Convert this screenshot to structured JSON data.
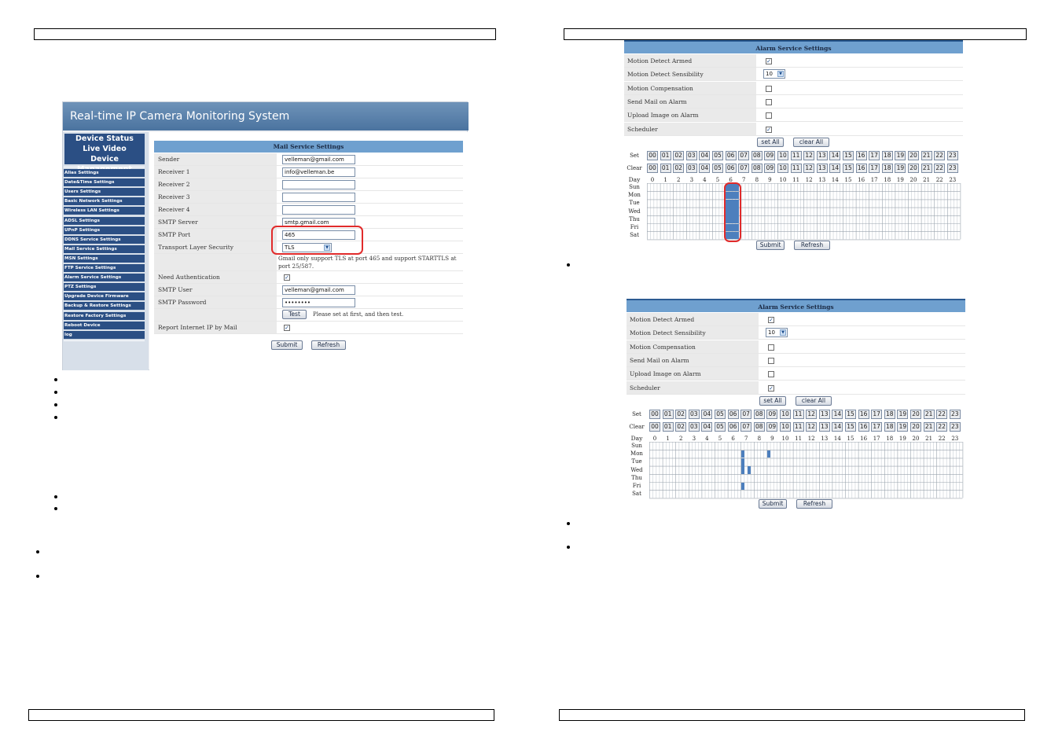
{
  "mail_service": {
    "app_title": "Real-time IP Camera Monitoring System",
    "nav_main": [
      "Device Status",
      "Live Video",
      "Device Management"
    ],
    "nav_sub": [
      "Alias Settings",
      "Date&Time Settings",
      "Users Settings",
      "Basic Network Settings",
      "Wireless LAN Settings",
      "ADSL Settings",
      "UPnP Settings",
      "DDNS Service Settings",
      "Mail Service Settings",
      "MSN Settings",
      "FTP Service Settings",
      "Alarm Service Settings",
      "PTZ Settings",
      "Upgrade Device Firmware",
      "Backup & Restore Settings",
      "Restore Factory Settings",
      "Reboot Device",
      "log"
    ],
    "panel_title": "Mail Service Settings",
    "fields": {
      "sender": {
        "label": "Sender",
        "value": "velleman@gmail.com"
      },
      "receiver1": {
        "label": "Receiver 1",
        "value": "info@velleman.be"
      },
      "receiver2": {
        "label": "Receiver 2",
        "value": ""
      },
      "receiver3": {
        "label": "Receiver 3",
        "value": ""
      },
      "receiver4": {
        "label": "Receiver 4",
        "value": ""
      },
      "smtp_server": {
        "label": "SMTP Server",
        "value": "smtp.gmail.com"
      },
      "smtp_port": {
        "label": "SMTP Port",
        "value": "465"
      },
      "tls": {
        "label": "Transport Layer Security",
        "value": "TLS"
      },
      "tls_note": "Gmail only support TLS at port 465 and support STARTTLS at port 25/587.",
      "need_auth": {
        "label": "Need Authentication",
        "checked": true
      },
      "smtp_user": {
        "label": "SMTP User",
        "value": "velleman@gmail.com"
      },
      "smtp_password": {
        "label": "SMTP Password",
        "value": "••••••••"
      },
      "test_button": "Test",
      "test_note": "Please set at first, and then test.",
      "report_ip": {
        "label": "Report Internet IP by Mail",
        "checked": true
      }
    },
    "submit_label": "Submit",
    "refresh_label": "Refresh"
  },
  "alarm_shared": {
    "title": "Alarm Service Settings",
    "labels": {
      "motion_armed": "Motion Detect Armed",
      "sensibility": "Motion Detect Sensibility",
      "compensation": "Motion Compensation",
      "send_mail": "Send Mail on Alarm",
      "upload_image": "Upload Image on Alarm",
      "scheduler": "Scheduler"
    },
    "sensibility_value": "10",
    "set_all": "set All",
    "clear_all": "clear All",
    "row_set": "Set",
    "row_clear": "Clear",
    "row_day": "Day",
    "hours_padded": [
      "00",
      "01",
      "02",
      "03",
      "04",
      "05",
      "06",
      "07",
      "08",
      "09",
      "10",
      "11",
      "12",
      "13",
      "14",
      "15",
      "16",
      "17",
      "18",
      "19",
      "20",
      "21",
      "22",
      "23"
    ],
    "hours_plain": [
      "0",
      "1",
      "2",
      "3",
      "4",
      "5",
      "6",
      "7",
      "8",
      "9",
      "10",
      "11",
      "12",
      "13",
      "14",
      "15",
      "16",
      "17",
      "18",
      "19",
      "20",
      "21",
      "22",
      "23"
    ],
    "days": [
      "Sun",
      "Mon",
      "Tue",
      "Wed",
      "Thu",
      "Fri",
      "Sat"
    ],
    "submit": "Submit",
    "refresh": "Refresh"
  },
  "alarm_top": {
    "checks": {
      "motion_armed": true,
      "compensation": false,
      "send_mail": false,
      "upload_image": false,
      "scheduler": true
    },
    "schedule": [
      {
        "day": 0,
        "hour": 6,
        "from": 0,
        "to": 4
      },
      {
        "day": 1,
        "hour": 6,
        "from": 0,
        "to": 4
      },
      {
        "day": 2,
        "hour": 6,
        "from": 0,
        "to": 4
      },
      {
        "day": 3,
        "hour": 6,
        "from": 0,
        "to": 4
      },
      {
        "day": 4,
        "hour": 6,
        "from": 0,
        "to": 4
      },
      {
        "day": 5,
        "hour": 6,
        "from": 0,
        "to": 4
      },
      {
        "day": 6,
        "hour": 6,
        "from": 0,
        "to": 4
      }
    ]
  },
  "alarm_bottom": {
    "checks": {
      "motion_armed": true,
      "compensation": false,
      "send_mail": false,
      "upload_image": false,
      "scheduler": true
    },
    "schedule": [
      {
        "day": 1,
        "hour": 7,
        "from": 0,
        "to": 1
      },
      {
        "day": 1,
        "hour": 9,
        "from": 0,
        "to": 1
      },
      {
        "day": 2,
        "hour": 7,
        "from": 0,
        "to": 1
      },
      {
        "day": 3,
        "hour": 7,
        "from": 0,
        "to": 1
      },
      {
        "day": 3,
        "hour": 7,
        "from": 2,
        "to": 3
      },
      {
        "day": 5,
        "hour": 7,
        "from": 0,
        "to": 1
      }
    ]
  }
}
